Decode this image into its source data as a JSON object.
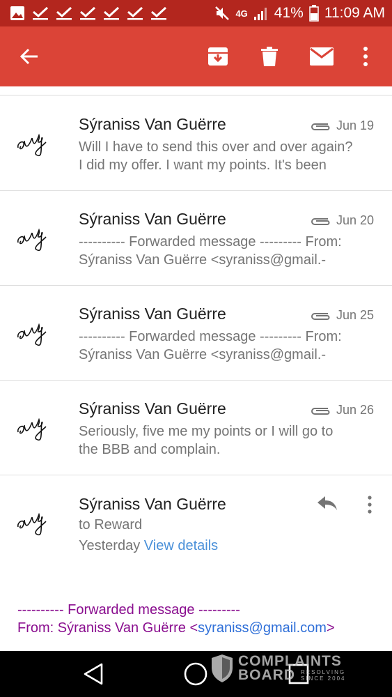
{
  "status_bar": {
    "network": "4G",
    "battery": "41%",
    "time": "11:09 AM",
    "icons": [
      "image-icon",
      "check-icon",
      "check-icon",
      "check-icon",
      "check-icon",
      "check-icon",
      "check-icon",
      "mute-icon",
      "signal-icon",
      "battery-icon"
    ]
  },
  "app_bar": {
    "color": "#db4437",
    "actions": [
      "back-arrow-icon",
      "archive-icon",
      "delete-icon",
      "mail-icon",
      "more-vert-icon"
    ]
  },
  "messages": [
    {
      "sender": "Sýraniss Van Guërre",
      "date": "Jun 19",
      "attachment": true,
      "snippet_1": "Will I have to send this over and over again?",
      "snippet_2": "I did my offer. I want my points. It's been"
    },
    {
      "sender": "Sýraniss Van Guërre",
      "date": "Jun 20",
      "attachment": true,
      "snippet_1": "---------- Forwarded message --------- From:",
      "snippet_2": "Sýraniss Van Guërre <syraniss@gmail.-"
    },
    {
      "sender": "Sýraniss Van Guërre",
      "date": "Jun 25",
      "attachment": true,
      "snippet_1": "---------- Forwarded message --------- From:",
      "snippet_2": "Sýraniss Van Guërre <syraniss@gmail.-"
    },
    {
      "sender": "Sýraniss Van Guërre",
      "date": "Jun 26",
      "attachment": true,
      "snippet_1": "Seriously, five me my points or I will go to",
      "snippet_2": "the BBB and complain."
    }
  ],
  "open_message": {
    "sender": "Sýraniss Van Guërre",
    "to": "to Reward",
    "when": "Yesterday",
    "view_details": "View details",
    "forward_header": "---------- Forwarded message ---------",
    "from_prefix": "From: Sýraniss Van Guërre <",
    "from_email": "syraniss@gmail.com",
    "from_suffix": ">"
  },
  "nav_bar": {
    "buttons": [
      "back-triangle-icon",
      "home-circle-icon",
      "recents-square-icon"
    ]
  },
  "watermark": {
    "line1": "COMPLAINTS",
    "line2": "BOARD",
    "line3": "RESOLVING",
    "line4": "SINCE 2004"
  }
}
